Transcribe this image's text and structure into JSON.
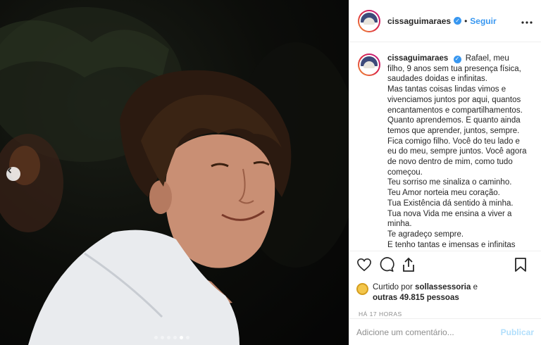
{
  "post": {
    "username": "cissaguimaraes",
    "separator": "•",
    "follow_label": "Seguir",
    "more_label": "•••",
    "caption_lines": [
      "Rafael, meu filho, 9 anos sem tua presença física, saudades doidas e infinitas.",
      "Mas tantas coisas lindas vimos e vivenciamos juntos por aqui, quantos encantamentos e compartilhamentos.",
      "Quanto aprendemos. E quanto ainda temos que aprender, juntos, sempre.",
      "Fica comigo filho. Você do teu lado e eu do meu, sempre juntos. Você agora de novo dentro de mim, como tudo começou.",
      "Teu sorriso me sinaliza o caminho.",
      "Teu Amor norteia meu coração.",
      "Tua Existência dá sentido à minha.",
      "Tua nova Vida me ensina a viver a minha.",
      "Te agradeço sempre.",
      "E tenho tantas e imensas e infinitas"
    ],
    "likes": {
      "prefix": "Curtido por ",
      "user": "sollassessoria",
      "middle": " e ",
      "others": "outras 49.815 pessoas"
    },
    "time": "HÁ 17 HORAS",
    "comment_placeholder": "Adicione um comentário...",
    "publish_label": "Publicar"
  },
  "carousel": {
    "dot_count": 6,
    "active_index": 4
  },
  "icons": {
    "like": "heart-icon",
    "comment": "comment-icon",
    "share": "share-icon",
    "save": "bookmark-icon",
    "prev": "chevron-left-icon",
    "verified": "verified-badge-icon"
  },
  "colors": {
    "accent": "#3897f0",
    "publish_disabled": "#b2dffc",
    "muted": "#8e8e8e",
    "text": "#262626"
  }
}
